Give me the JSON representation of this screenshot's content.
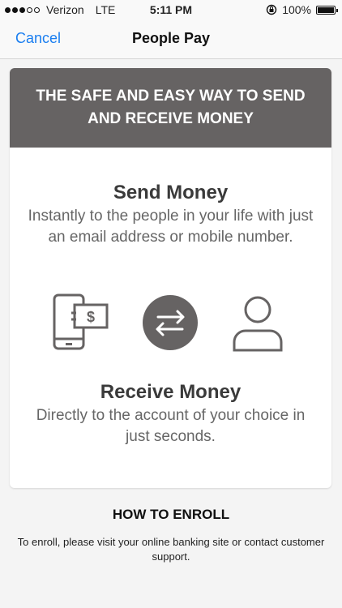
{
  "status_bar": {
    "carrier": "Verizon",
    "network": "LTE",
    "time": "5:11 PM",
    "battery": "100%",
    "battery_level": 1.0,
    "signal_bars_filled": 3,
    "signal_bars_total": 5
  },
  "nav": {
    "cancel_label": "Cancel",
    "title": "People Pay"
  },
  "card": {
    "header": "THE SAFE AND EASY WAY TO SEND AND RECEIVE MONEY",
    "send_title": "Send Money",
    "send_body": "Instantly to the people in your life with just an email address or mobile number.",
    "receive_title": "Receive Money",
    "receive_body": "Directly to the account of your choice in just seconds.",
    "dollar_symbol": "$"
  },
  "enroll": {
    "title": "HOW TO ENROLL",
    "text": "To enroll, please visit your online banking site or contact customer support."
  },
  "colors": {
    "accent": "#1a7ef0",
    "header_bg": "#666363",
    "icon_gray": "#666363"
  }
}
